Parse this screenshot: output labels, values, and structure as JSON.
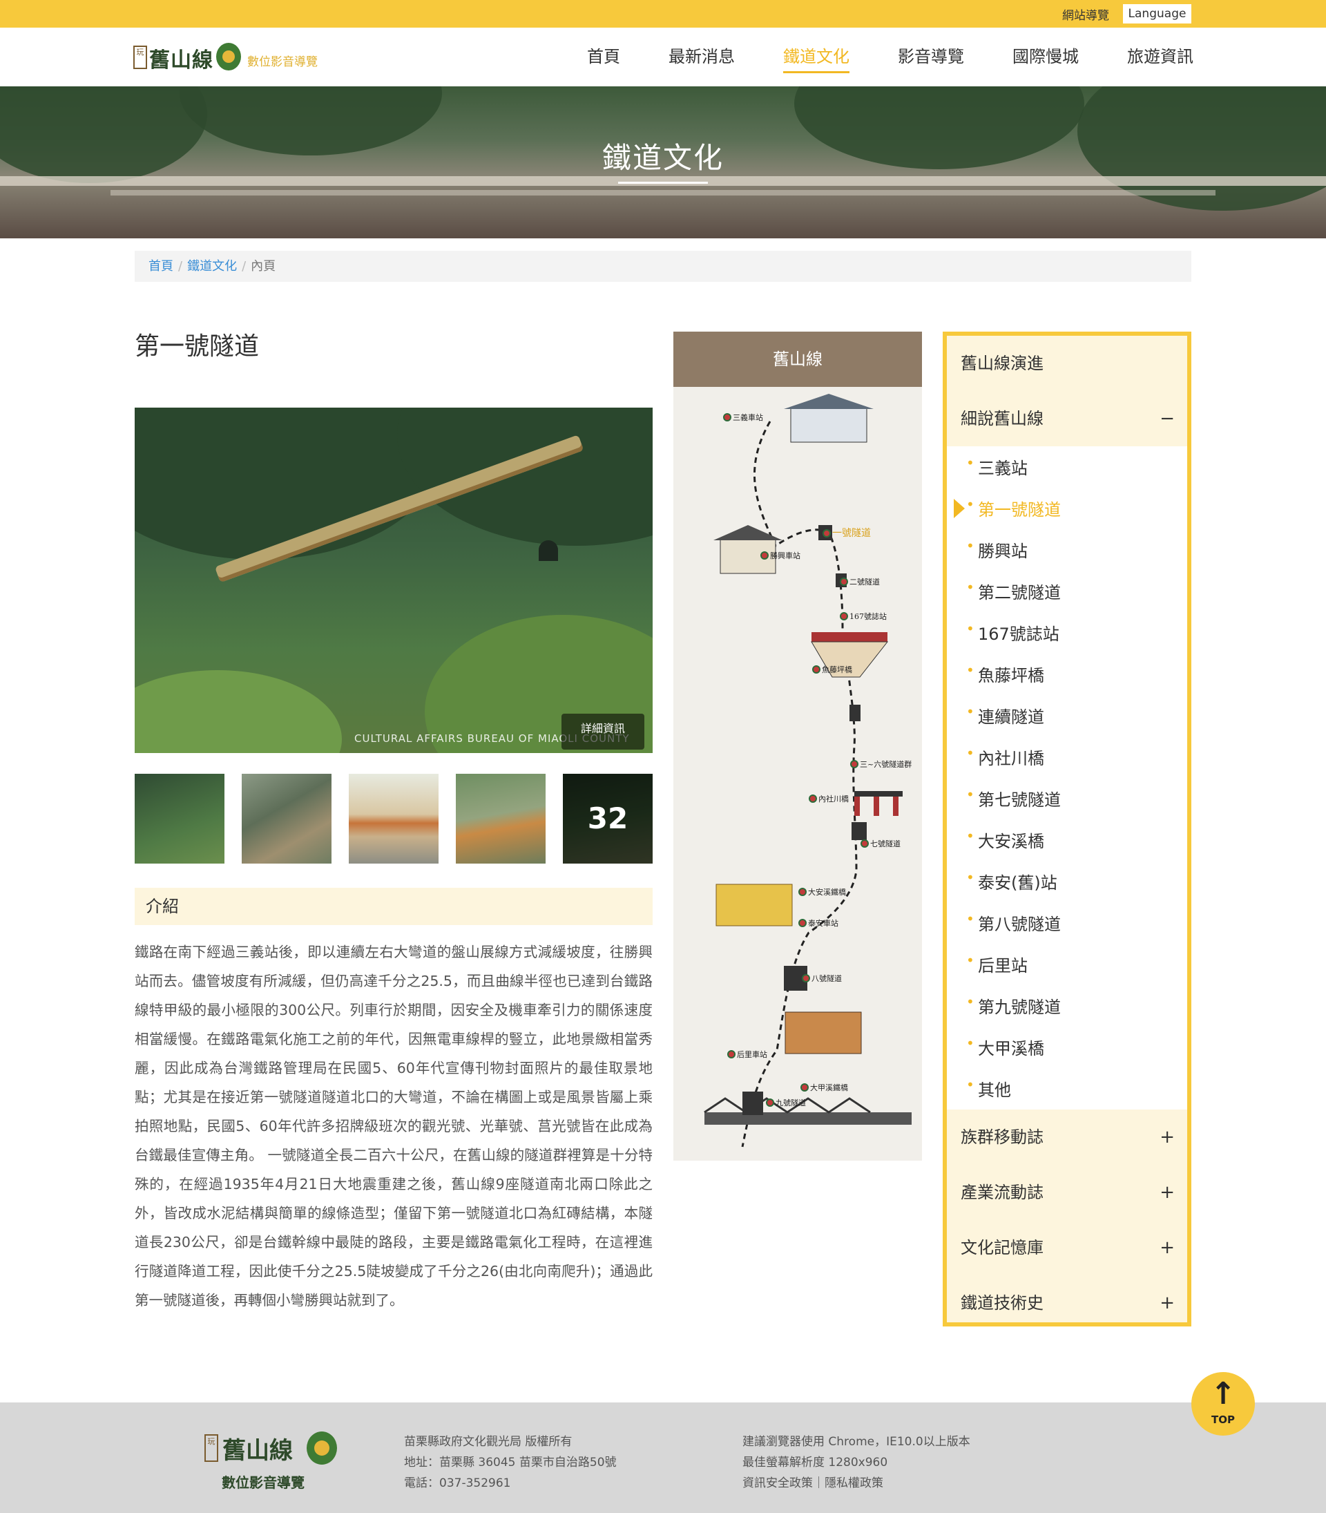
{
  "topbar": {
    "sitemap": "網站導覽",
    "language": "Language"
  },
  "logo": {
    "play": "玩",
    "name": "舊山線",
    "sub": "數位影音導覽"
  },
  "nav": [
    "首頁",
    "最新消息",
    "鐵道文化",
    "影音導覽",
    "國際慢城",
    "旅遊資訊"
  ],
  "nav_active": "鐵道文化",
  "banner": {
    "title": "鐵道文化"
  },
  "breadcrumb": {
    "home": "首頁",
    "section": "鐵道文化",
    "current": "內頁"
  },
  "page_title": "第一號隧道",
  "gallery": {
    "credit": "CULTURAL AFFAIRS BUREAU OF MIAOLI COUNTY",
    "detail": "詳細資訊",
    "more_count": "32"
  },
  "intro": {
    "heading": "介紹",
    "text": "鐵路在南下經過三義站後，即以連續左右大彎道的盤山展線方式減緩坡度，往勝興站而去。儘管坡度有所減緩，但仍高達千分之25.5，而且曲線半徑也已達到台鐵路線特甲級的最小極限的300公尺。列車行於期間，因安全及機車牽引力的關係速度相當緩慢。在鐵路電氣化施工之前的年代，因無電車線桿的豎立，此地景緻相當秀麗，因此成為台灣鐵路管理局在民國5、60年代宣傳刊物封面照片的最佳取景地點；尤其是在接近第一號隧道隧道北口的大彎道，不論在構圖上或是風景皆屬上乘拍照地點，民國5、60年代許多招牌級班次的觀光號、光華號、莒光號皆在此成為台鐵最佳宣傳主角。 一號隧道全長二百六十公尺，在舊山線的隧道群裡算是十分特殊的，在經過1935年4月21日大地震重建之後，舊山線9座隧道南北兩口除此之外，皆改成水泥結構與簡單的線條造型；僅留下第一號隧道北口為紅磚結構，本隧道長230公尺，卻是台鐵幹線中最陡的路段，主要是鐵路電氣化工程時，在這裡進行隧道降道工程，因此使千分之25.5陡坡變成了千分之26(由北向南爬升)；通過此第一號隧道後，再轉個小彎勝興站就到了。"
  },
  "map": {
    "title": "舊山線",
    "labels": [
      "三義車站",
      "一號隧道",
      "勝興車站",
      "二號隧道",
      "167號誌站",
      "魚藤坪橋",
      "三~六號隧道群",
      "內社川橋",
      "七號隧道",
      "大安溪鐵橋",
      "泰安車站",
      "八號隧道",
      "后里車站",
      "九號隧道",
      "大甲溪鐵橋"
    ]
  },
  "sidebar": {
    "top_items": [
      {
        "label": "舊山線演進",
        "pm": ""
      },
      {
        "label": "細說舊山線",
        "pm": "−"
      }
    ],
    "sub_items": [
      "三義站",
      "第一號隧道",
      "勝興站",
      "第二號隧道",
      "167號誌站",
      "魚藤坪橋",
      "連續隧道",
      "內社川橋",
      "第七號隧道",
      "大安溪橋",
      "泰安(舊)站",
      "第八號隧道",
      "后里站",
      "第九號隧道",
      "大甲溪橋",
      "其他"
    ],
    "active_sub": "第一號隧道",
    "bottom_items": [
      {
        "label": "族群移動誌",
        "pm": "+"
      },
      {
        "label": "產業流動誌",
        "pm": "+"
      },
      {
        "label": "文化記憶庫",
        "pm": "+"
      },
      {
        "label": "鐵道技術史",
        "pm": "+"
      }
    ]
  },
  "footer": {
    "logo_play": "玩",
    "logo_name": "舊山線",
    "logo_sub": "數位影音導覽",
    "col1": [
      "苗栗縣政府文化觀光局 版權所有",
      "地址：苗栗縣 36045 苗栗市自治路50號",
      "電話：037-352961"
    ],
    "col2": [
      "建議瀏覽器使用 Chrome，IE10.0以上版本",
      "最佳螢幕解析度 1280x960",
      "資訊安全政策｜隱私權政策"
    ]
  },
  "totop": {
    "label": "TOP",
    "arrow": "↑"
  }
}
